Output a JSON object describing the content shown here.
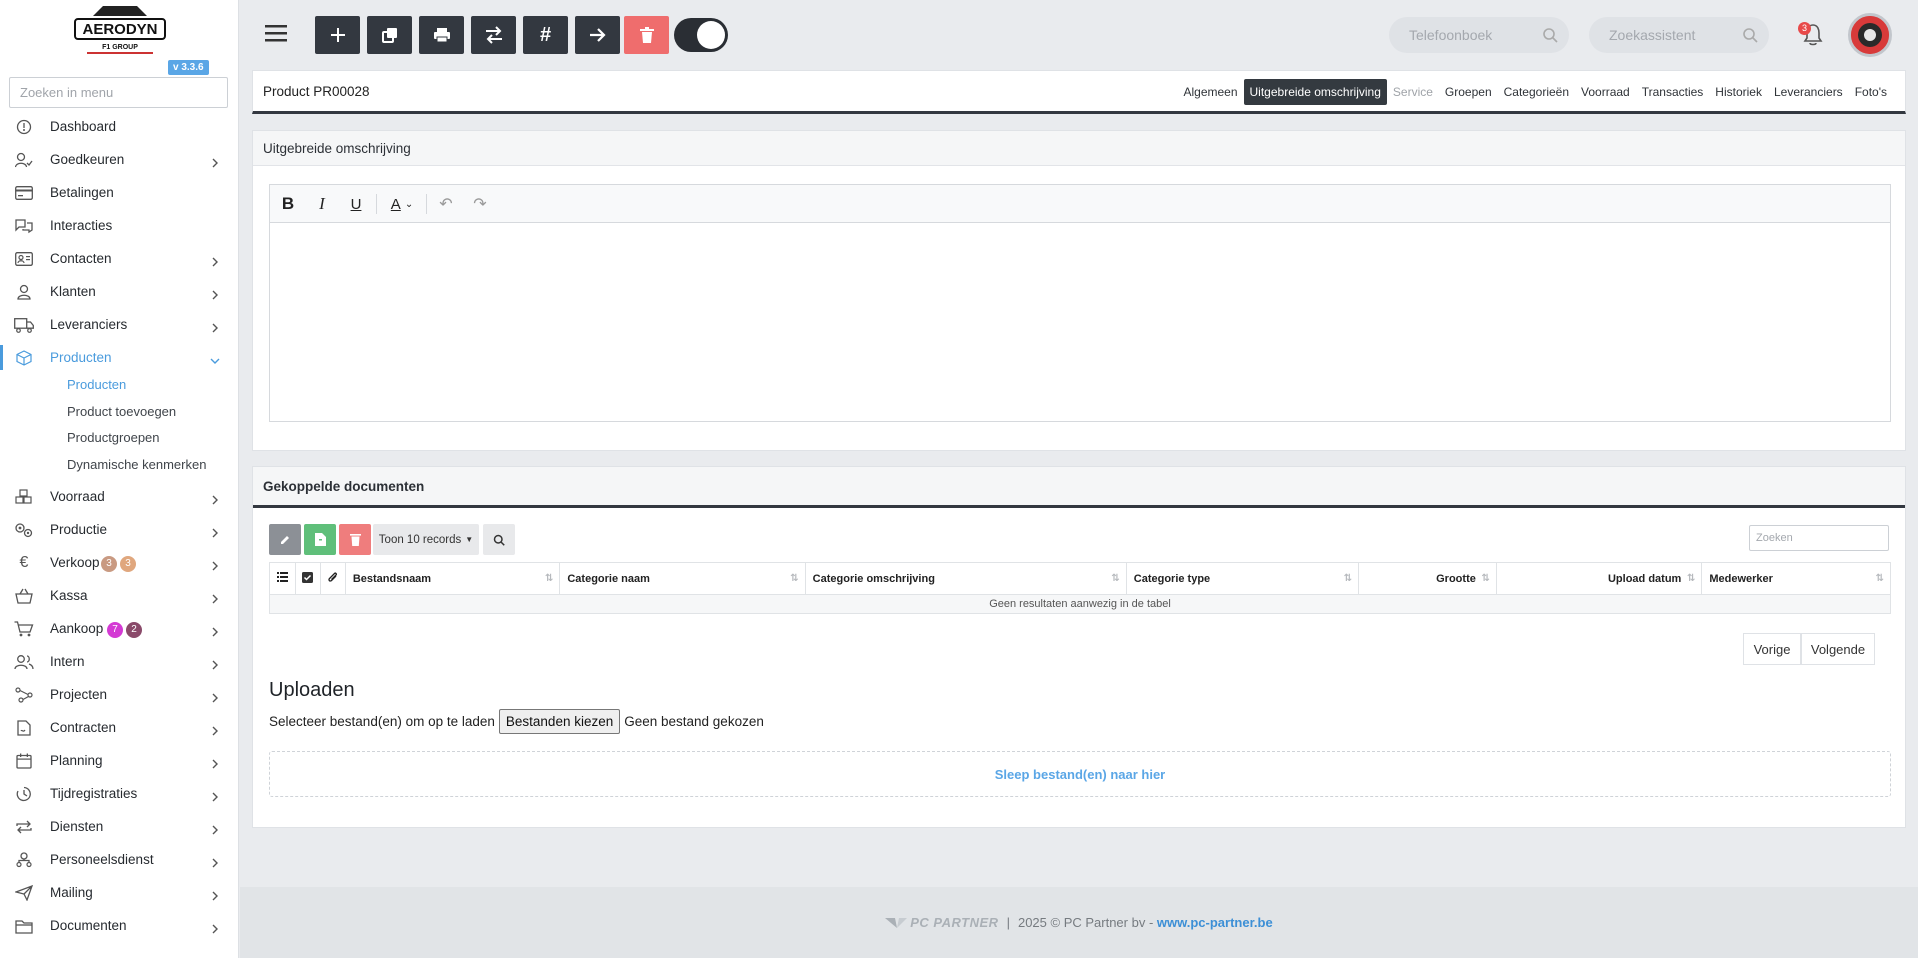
{
  "brand": {
    "name": "AERODYN",
    "subtitle": "F1 GROUP",
    "version": "v 3.3.6"
  },
  "sidebar": {
    "search_placeholder": "Zoeken in menu",
    "items": [
      {
        "label": "Dashboard",
        "icon": "dashboard-icon"
      },
      {
        "label": "Goedkeuren",
        "icon": "user-check-icon"
      },
      {
        "label": "Betalingen",
        "icon": "card-icon"
      },
      {
        "label": "Interacties",
        "icon": "chat-icon"
      },
      {
        "label": "Contacten",
        "icon": "contact-card-icon"
      },
      {
        "label": "Klanten",
        "icon": "user-icon"
      },
      {
        "label": "Leveranciers",
        "icon": "truck-icon"
      },
      {
        "label": "Producten",
        "icon": "box-icon"
      },
      {
        "label": "Voorraad",
        "icon": "boxes-icon"
      },
      {
        "label": "Productie",
        "icon": "gears-icon"
      },
      {
        "label": "Verkoop",
        "icon": "euro-icon"
      },
      {
        "label": "Kassa",
        "icon": "basket-icon"
      },
      {
        "label": "Aankoop",
        "icon": "cart-icon"
      },
      {
        "label": "Intern",
        "icon": "users-icon"
      },
      {
        "label": "Projecten",
        "icon": "nodes-icon"
      },
      {
        "label": "Contracten",
        "icon": "contract-icon"
      },
      {
        "label": "Planning",
        "icon": "calendar-icon"
      },
      {
        "label": "Tijdregistraties",
        "icon": "clock-icon"
      },
      {
        "label": "Diensten",
        "icon": "repeat-icon"
      },
      {
        "label": "Personeelsdienst",
        "icon": "org-icon"
      },
      {
        "label": "Mailing",
        "icon": "send-icon"
      },
      {
        "label": "Documenten",
        "icon": "folder-icon"
      }
    ],
    "subitems": [
      "Producten",
      "Product toevoegen",
      "Productgroepen",
      "Dynamische kenmerken"
    ],
    "verkoop_badges": [
      "3",
      "3"
    ],
    "aankoop_badges": [
      "7",
      "2"
    ]
  },
  "topbar": {
    "phonebook_placeholder": "Telefoonboek",
    "assistant_placeholder": "Zoekassistent",
    "notifications": "3"
  },
  "product": {
    "title": "Product PR00028",
    "tabs": [
      "Algemeen",
      "Uitgebreide omschrijving",
      "Service",
      "Groepen",
      "Categorieën",
      "Voorraad",
      "Transacties",
      "Historiek",
      "Leveranciers",
      "Foto's"
    ]
  },
  "description": {
    "title": "Uitgebreide omschrijving"
  },
  "documents": {
    "title": "Gekoppelde documenten",
    "show_records": "Toon 10 records",
    "search_placeholder": "Zoeken",
    "columns": [
      "Bestandsnaam",
      "Categorie naam",
      "Categorie omschrijving",
      "Categorie type",
      "Grootte",
      "Upload datum",
      "Medewerker"
    ],
    "empty": "Geen resultaten aanwezig in de tabel",
    "prev": "Vorige",
    "next": "Volgende"
  },
  "upload": {
    "title": "Uploaden",
    "prompt": "Selecteer bestand(en) om op te laden",
    "choose": "Bestanden kiezen",
    "none": "Geen bestand gekozen",
    "dropzone": "Sleep bestand(en) naar hier"
  },
  "footer": {
    "logo": "PC PARTNER",
    "sep": "|",
    "copyright": "2025 © PC Partner bv - ",
    "link": "www.pc-partner.be"
  },
  "colors": {
    "accent": "#4a9bdd",
    "dark": "#333840",
    "danger": "#ef6d6d",
    "success": "#5fbf7a"
  }
}
